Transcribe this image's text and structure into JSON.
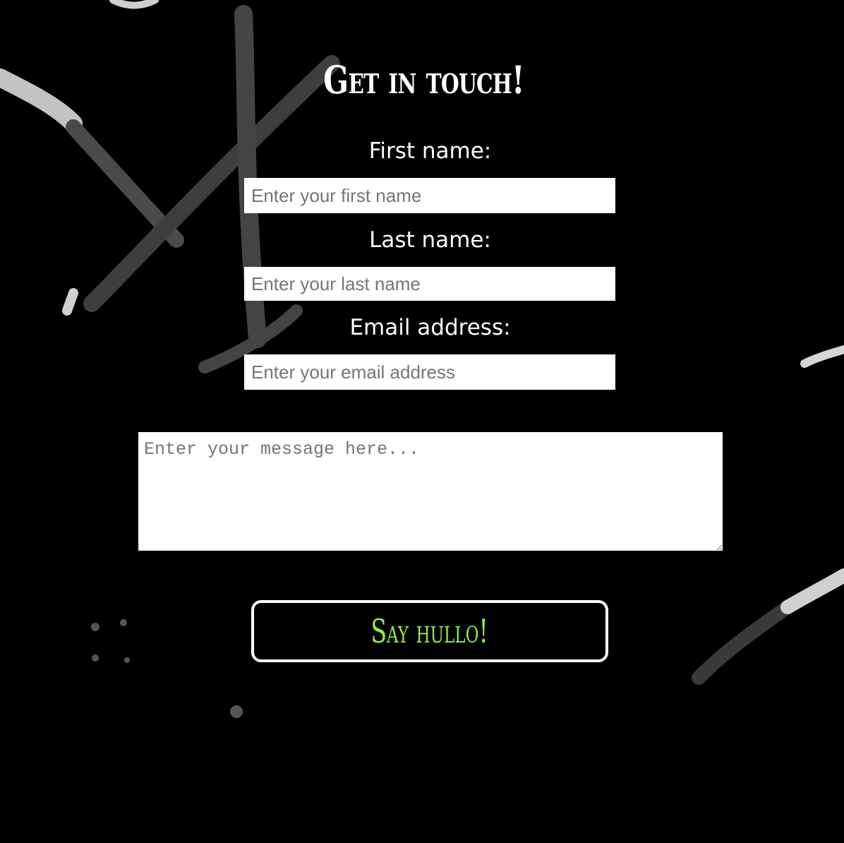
{
  "contact": {
    "title": "Get in touch!",
    "first_name_label": "First name:",
    "first_name_placeholder": "Enter your first name",
    "last_name_label": "Last name:",
    "last_name_placeholder": "Enter your last name",
    "email_label": "Email address:",
    "email_placeholder": "Enter your email address",
    "message_placeholder": "Enter your message here...",
    "submit_label": "Say hullo!"
  },
  "colors": {
    "background": "#000000",
    "text": "#ffffff",
    "button_text": "#8ff23a",
    "button_border": "#ffffff",
    "decoration": "#cfcfcf"
  }
}
